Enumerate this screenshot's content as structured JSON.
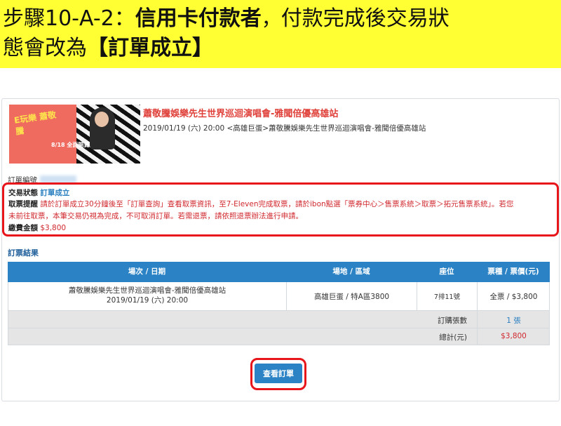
{
  "banner": {
    "line1_prefix": "步驟10-A-2：",
    "line1_bold": "信用卡付款者",
    "line1_mid": "，",
    "line1_rest": "付款完成後交易狀",
    "line2_prefix": "態會改為",
    "line2_bold": "【訂單成立】"
  },
  "event": {
    "title": "蕭敬騰娛樂先生世界巡迴演唱會-雅聞倍優高雄站",
    "subtitle": "2019/01/19 (六) 20:00 <高雄巨蛋>蕭敬騰娛樂先生世界巡迴演唱會-雅聞倍優高雄站",
    "image_text": "E玩樂 蕭敬騰",
    "image_date": "8/18 全面開賣"
  },
  "order": {
    "number_label": "訂單編號"
  },
  "status": {
    "label": "交易狀態",
    "value": "訂單成立"
  },
  "notice": {
    "label": "取票提醒",
    "line1": "請於訂單成立30分鐘後至「訂單查詢」查看取票資訊，至7-Eleven完成取票，請於ibon點選「票券中心＞售票系統＞取票＞拓元售票系統」。若您",
    "line2": "未前往取票，本筆交易仍視為完成，不可取消訂單。若需退票，請依照退票辦法進行申請。"
  },
  "fee": {
    "label": "繳費金額",
    "value": "$3,800"
  },
  "result": {
    "title": "訂票結果",
    "headers": [
      "場次 / 日期",
      "場地 / 區域",
      "座位",
      "票種 / 票價(元)"
    ],
    "row": {
      "session_line1": "蕭敬騰娛樂先生世界巡迴演唱會-雅聞倍優高雄站",
      "session_line2": "2019/01/19 (六) 20:00",
      "venue": "高雄巨蛋 / 特A區3800",
      "seat": "7排11號",
      "ticket": "全票 / $3,800"
    },
    "count_label": "訂購張數",
    "count_value": "1 張",
    "total_label": "總計(元)",
    "total_value": "$3,800"
  },
  "actions": {
    "view_order": "查看訂單"
  },
  "colors": {
    "banner_bg": "#ffff33",
    "accent_blue": "#2b83c5",
    "highlight_red": "#e8151b",
    "price_red": "#d0282e"
  }
}
